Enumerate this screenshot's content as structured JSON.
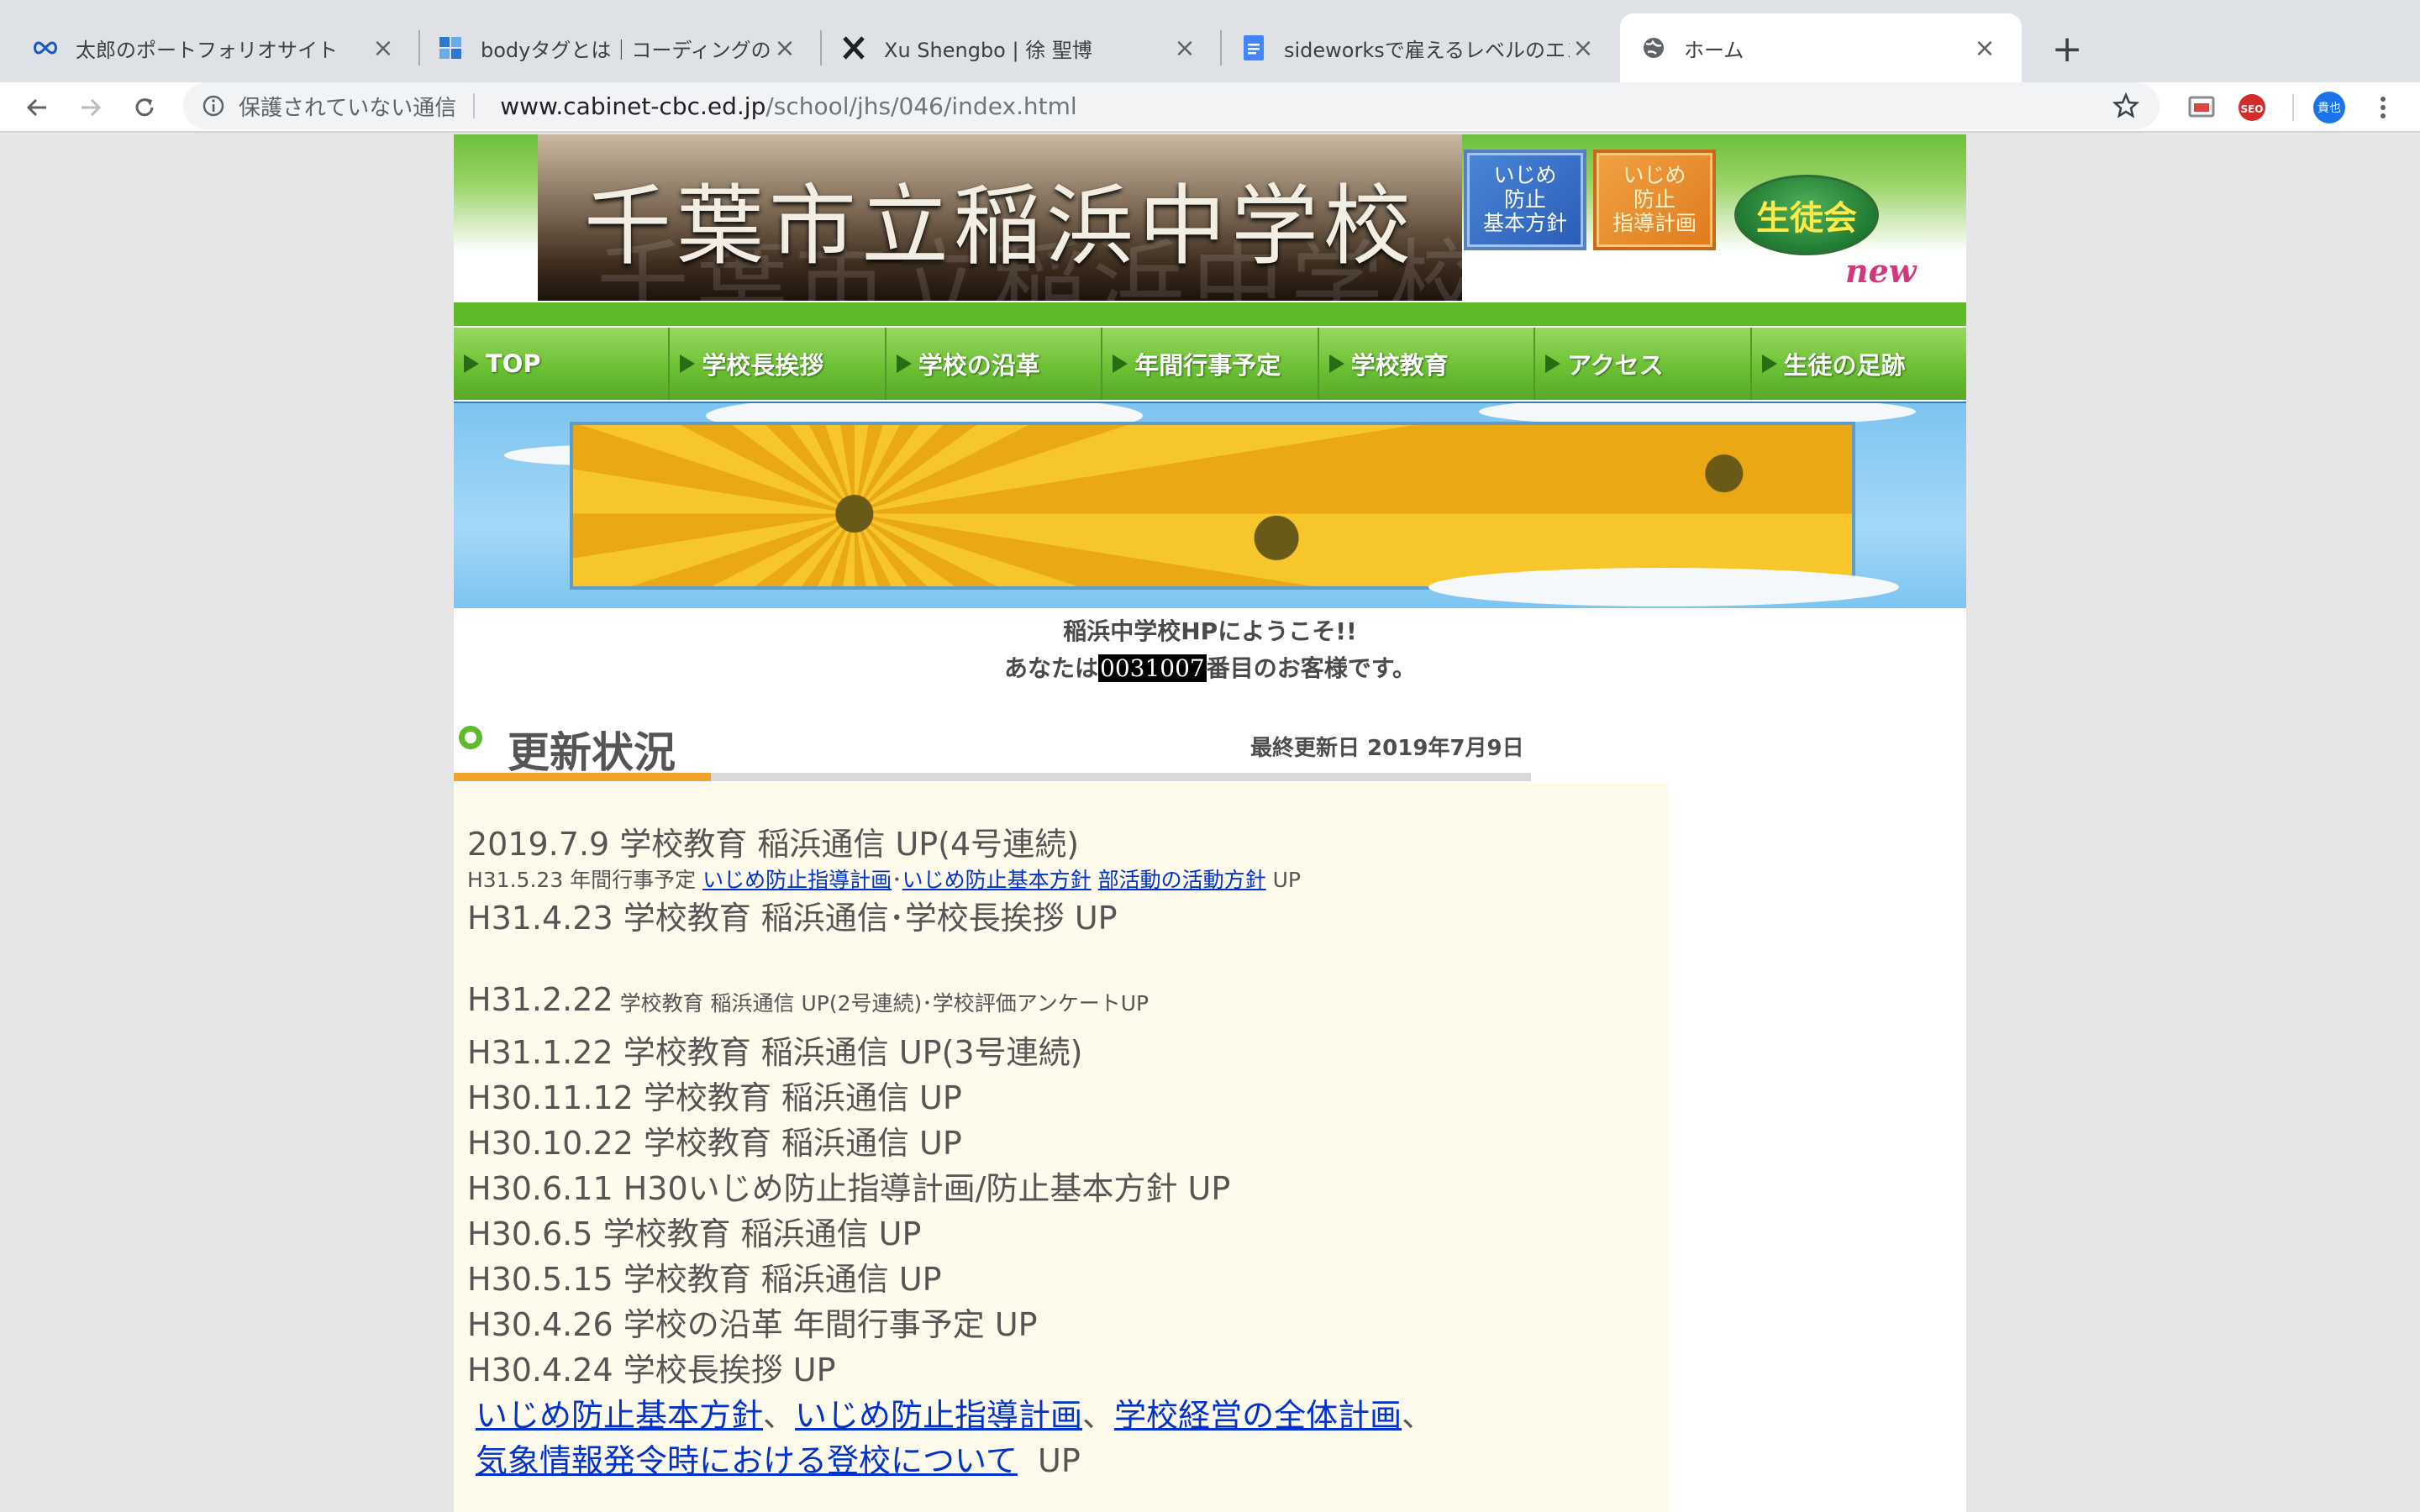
{
  "browser": {
    "tabs": [
      {
        "title": "太郎のポートフォリオサイト",
        "icon": "infinity-icon"
      },
      {
        "title": "bodyタグとは｜コーディングのプ",
        "icon": "puzzle-icon"
      },
      {
        "title": "Xu Shengbo | 徐 聖博",
        "icon": "x-logo-icon"
      },
      {
        "title": "sideworksで雇えるレベルのエンジ",
        "icon": "docs-icon"
      },
      {
        "title": "ホーム",
        "icon": "globe-icon"
      }
    ],
    "insecure_label": "保護されていない通信",
    "url_host": "www.cabinet-cbc.ed.jp",
    "url_path": "/school/jhs/046/index.html",
    "profile_initials": "貴也",
    "ext_seo_label": "SEO"
  },
  "header": {
    "school_name": "千葉市立稲浜中学校",
    "btn_policy": [
      "いじめ",
      "防止",
      "基本方針"
    ],
    "btn_plan": [
      "いじめ",
      "防止",
      "指導計画"
    ],
    "council": "生徒会",
    "new_badge": "new"
  },
  "nav": [
    "TOP",
    "学校長挨拶",
    "学校の沿革",
    "年間行事予定",
    "学校教育",
    "アクセス",
    "生徒の足跡"
  ],
  "welcome": {
    "line1": "稲浜中学校HPにようこそ!!",
    "line2_pre": "あなたは",
    "counter": "0031007",
    "line2_post": "番目のお客様です。"
  },
  "updates": {
    "title": "更新状況",
    "last_updated": "最終更新日 2019年7月9日",
    "items": {
      "r1": "2019.7.9 学校教育 稲浜通信 UP(4号連続)",
      "r2_pre": "H31.5.23 年間行事予定 ",
      "r2_link1": "いじめ防止指導計画",
      "r2_sep": "･",
      "r2_link2": "いじめ防止基本方針",
      "r2_link3": "部活動の活動方針",
      "r2_post": " UP",
      "r3": "H31.4.23 学校教育 稲浜通信･学校長挨拶 UP",
      "r4_date": "H31.2.22",
      "r4_text": " 学校教育 稲浜通信 UP(2号連続)･学校評価アンケートUP",
      "r5": "H31.1.22 学校教育 稲浜通信 UP(3号連続)",
      "r6": "H30.11.12 学校教育 稲浜通信 UP",
      "r7": "H30.10.22 学校教育 稲浜通信 UP",
      "r8": "H30.6.11 H30いじめ防止指導計画/防止基本方針 UP",
      "r9": "H30.6.5  学校教育 稲浜通信 UP",
      "r10": "H30.5.15 学校教育 稲浜通信 UP",
      "r11": "H30.4.26 学校の沿革 年間行事予定 UP",
      "r12": "H30.4.24 学校長挨拶 UP",
      "r13_link1": "いじめ防止基本方針",
      "r13_link2": "いじめ防止指導計画",
      "r13_link3": "学校経営の全体計画",
      "r13_comma": "、",
      "r14_link": "気象情報発令時における登校について",
      "r14_post": "  UP"
    }
  }
}
